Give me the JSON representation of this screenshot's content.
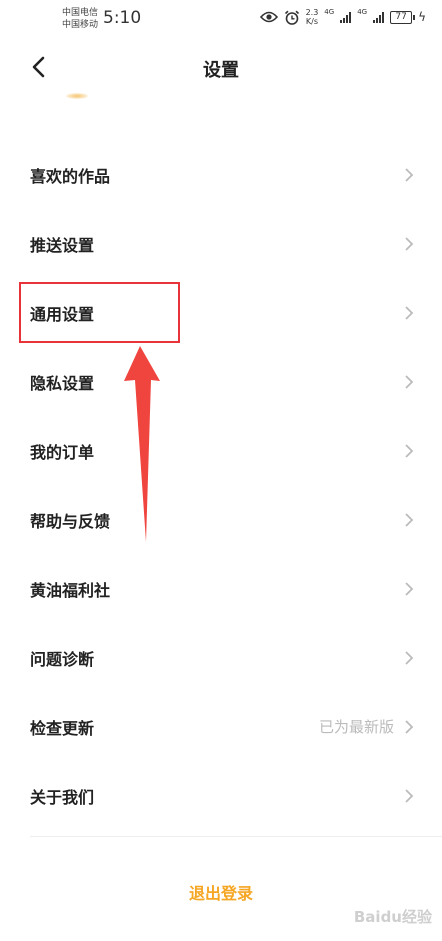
{
  "status_bar": {
    "carrier_1": "中国电信",
    "carrier_2": "中国移动",
    "time": "5:10",
    "net_speed_value": "2.3",
    "net_speed_unit": "K/s",
    "network_1": "4G",
    "network_2": "4G",
    "battery": "77"
  },
  "nav": {
    "title": "设置"
  },
  "menu": {
    "items": [
      {
        "label": "喜欢的作品"
      },
      {
        "label": "推送设置"
      },
      {
        "label": "通用设置"
      },
      {
        "label": "隐私设置"
      },
      {
        "label": "我的订单"
      },
      {
        "label": "帮助与反馈"
      },
      {
        "label": "黄油福利社"
      },
      {
        "label": "问题诊断"
      },
      {
        "label": "检查更新",
        "value": "已为最新版"
      },
      {
        "label": "关于我们"
      }
    ]
  },
  "logout_label": "退出登录",
  "watermark": "Baidu经验",
  "colors": {
    "accent": "#f5a623",
    "annotation": "#e8333a"
  }
}
